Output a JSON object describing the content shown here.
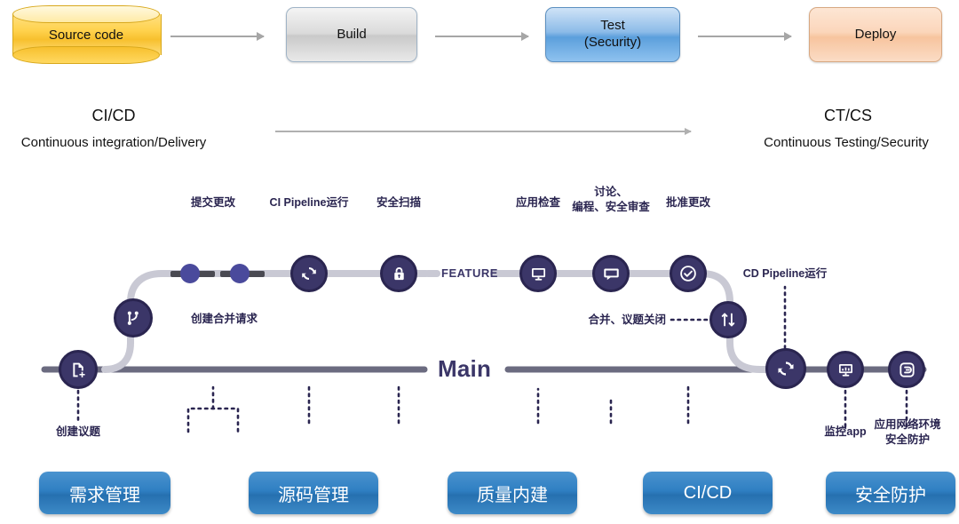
{
  "pipeline": {
    "stages": [
      {
        "id": "source-code",
        "label": "Source code",
        "shape": "cylinder",
        "color": "#ffd24d"
      },
      {
        "id": "build",
        "label": "Build",
        "shape": "box",
        "color": "#c9c9c9"
      },
      {
        "id": "test",
        "label": "Test\n(Security)",
        "line1": "Test",
        "line2": "(Security)",
        "shape": "box",
        "color": "#5b9fdc"
      },
      {
        "id": "deploy",
        "label": "Deploy",
        "shape": "box",
        "color": "#f7c49e"
      }
    ],
    "arrow_color": "#a6a6a6"
  },
  "band": {
    "left_title": "CI/CD",
    "left_subtitle": "Continuous integration/Delivery",
    "right_title": "CT/CS",
    "right_subtitle": "Continuous Testing/Security",
    "arrow_color": "#b0b0b0"
  },
  "git": {
    "main_branch_label": "Main",
    "feature_branch_label": "FEATURE",
    "node_fill": "#3b3668",
    "node_stroke": "#2a2550",
    "main_line_color": "#6b6b80",
    "feature_line_color": "#c9c9d4",
    "nodes": [
      {
        "id": "create-issue",
        "icon": "new-issue-icon",
        "label": "创建议题",
        "label_pos": "below"
      },
      {
        "id": "create-mr",
        "icon": "branch-icon",
        "label": "创建合并请求",
        "label_pos": "right"
      },
      {
        "id": "commit-1",
        "icon": "commit-dot",
        "label": "提交更改",
        "label_pos": "above"
      },
      {
        "id": "commit-2",
        "icon": "commit-dot",
        "label": "",
        "label_pos": "above"
      },
      {
        "id": "ci-pipeline",
        "icon": "sync-icon",
        "label": "CI Pipeline运行",
        "label_pos": "above"
      },
      {
        "id": "security-scan",
        "icon": "lock-icon",
        "label": "安全扫描",
        "label_pos": "above"
      },
      {
        "id": "app-check",
        "icon": "monitor-icon",
        "label": "应用检查",
        "label_pos": "above"
      },
      {
        "id": "review",
        "icon": "comment-icon",
        "label": "讨论、\n编程、安全审查",
        "label_line1": "讨论、",
        "label_line2": "编程、安全审查",
        "label_pos": "above"
      },
      {
        "id": "approve-change",
        "icon": "check-circle-icon",
        "label": "批准更改",
        "label_pos": "above"
      },
      {
        "id": "merge-close",
        "icon": "merge-icon",
        "label": "合并、议题关闭",
        "label_pos": "left"
      },
      {
        "id": "cd-pipeline",
        "icon": "sync-icon",
        "label": "CD Pipeline运行",
        "label_pos": "above"
      },
      {
        "id": "monitor-app",
        "icon": "dashboard-icon",
        "label": "监控app",
        "label_pos": "below"
      },
      {
        "id": "app-net-security",
        "icon": "shield-protect-icon",
        "label": "应用网络环境\n安全防护",
        "label_line1": "应用网络环境",
        "label_line2": "安全防护",
        "label_pos": "below"
      }
    ]
  },
  "capabilities": {
    "chips": [
      {
        "id": "requirements-management",
        "label": "需求管理"
      },
      {
        "id": "source-management",
        "label": "源码管理"
      },
      {
        "id": "quality-builtin",
        "label": "质量内建"
      },
      {
        "id": "ci-cd",
        "label": "CI/CD"
      },
      {
        "id": "security-protection",
        "label": "安全防护"
      }
    ],
    "chip_color": "#2f7fc2"
  }
}
